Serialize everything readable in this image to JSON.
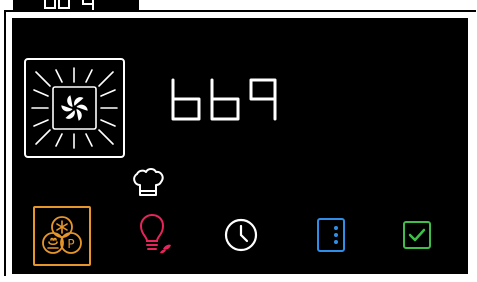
{
  "display": {
    "main_readout": "bb9",
    "top_fragment": "bb 4"
  },
  "icons": {
    "oven": "oven-fan-icon",
    "chef": "chef-hat-icon",
    "mode": "mode-selector-icon",
    "light": "lightbulb-icon",
    "clock": "clock-icon",
    "door": "door-icon",
    "confirm": "checkbox-icon"
  },
  "colors": {
    "panel": "#000000",
    "mode_accent": "#e6962a",
    "light_accent": "#e8245a",
    "door_accent": "#2f8fe8",
    "confirm_accent": "#3fbf4a",
    "icon_white": "#ffffff"
  }
}
